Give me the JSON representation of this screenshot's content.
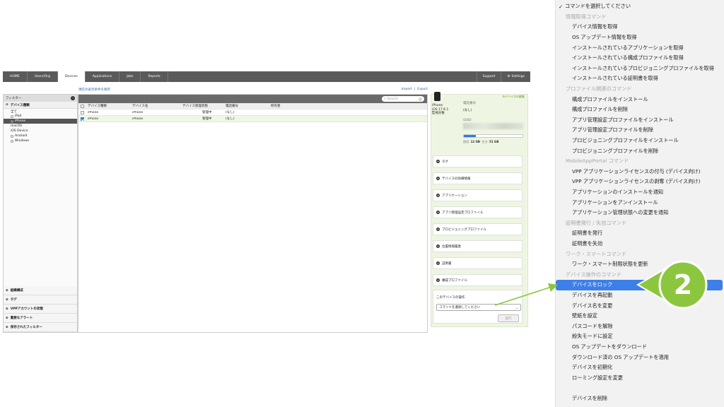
{
  "nav": {
    "tabs": [
      "HOME",
      "Users/Org",
      "Devices",
      "Applications",
      "Jobs",
      "Reports"
    ],
    "active_tab": "Devices",
    "support": "Support",
    "settings": "Settings"
  },
  "sidebar": {
    "filter_label": "フィルター",
    "device_type_group": "デバイス種類",
    "items": [
      "全て",
      "iPad",
      "iPhone",
      "macOS",
      "iOS Device",
      "Android",
      "Windows"
    ],
    "selected": "iPhone",
    "bottom_groups": [
      "組織構成",
      "タグ",
      "VPPアカウントの状態",
      "重要なアラート",
      "保存されたフィルター"
    ]
  },
  "main": {
    "save_filter_link": "現在の表示条件を保存",
    "import": "Import",
    "export": "Export",
    "search_placeholder": "Search",
    "columns": [
      "デバイス種類",
      "デバイス名",
      "デバイス管理状態",
      "電話番号",
      "所有者"
    ],
    "rows": [
      {
        "type": "iPhone",
        "name": "iPhone",
        "status": "管理中",
        "phone": "(なし)",
        "owner": "",
        "checked": false
      },
      {
        "type": "iPhone",
        "name": "iPhone",
        "status": "管理中",
        "phone": "(なし)",
        "owner": "",
        "checked": true
      }
    ]
  },
  "detail": {
    "edit_link": "デバイスの編集",
    "device_name": "iPhone",
    "os": "iOS 17.6.1",
    "status": "監視対象",
    "phone_label": "電話番号",
    "phone_value": "(なし)",
    "udid_label": "UDID",
    "storage_used_fraction": 0.2,
    "storage_used_label": "使用",
    "storage_used": "12 GB",
    "storage_free_label": "空き",
    "storage_free": "51 GB",
    "sections": [
      "タグ",
      "デバイスの詳細情報",
      "アプリケーション",
      "アプリ管理設定プロファイル",
      "プロビジョニングプロファイル",
      "位置情報履歴",
      "証明書",
      "構成プロファイル"
    ],
    "ops_title": "このデバイスの操作",
    "command_placeholder": "コマンドを選択してください",
    "run_button": "実行"
  },
  "menu": {
    "top": "コマンドを選択してください",
    "info_header": "情報取得コマンド",
    "info_items": [
      "デバイス情報を取得",
      "OS アップデート情報を取得",
      "インストールされているアプリケーションを取得",
      "インストールされている構成プロファイルを取得",
      "インストールされているプロビジョニングプロファイルを取得",
      "インストールされている証明書を取得"
    ],
    "profile_header": "プロファイル関連のコマンド",
    "profile_items": [
      "構成プロファイルをインストール",
      "構成プロファイルを削除",
      "アプリ管理設定プロファイルをインストール",
      "アプリ管理設定プロファイルを削除",
      "プロビジョニングプロファイルをインストール",
      "プロビジョニングプロファイルを削除"
    ],
    "mobileportal_header": "MobileAppPortal コマンド",
    "mobileportal_items": [
      "VPP アプリケーションライセンスの付与 (デバイス向け)",
      "VPP アプリケーションライセンスの剥奪 (デバイス向け)",
      "アプリケーションのインストールを通知",
      "アプリケーションをアンインストール",
      "アプリケーション管理状態への変更を通知"
    ],
    "cert_header": "証明書発行 / 失効コマンド",
    "cert_items": [
      "証明書を発行",
      "証明書を失効"
    ],
    "smart_header": "ワーク・スマートコマンド",
    "smart_items": [
      "ワーク・スマート制限状態を更新"
    ],
    "device_header": "デバイス操作のコマンド",
    "device_items": [
      "デバイスをロック",
      "デバイスを再起動",
      "デバイス名を変更",
      "壁紙を設定",
      "パスコードを解除",
      "紛失モードに設定",
      "OS アップデートをダウンロード",
      "ダウンロード済の OS アップデートを適用",
      "デバイスを初期化",
      "ローミング設定を変更"
    ],
    "delete_item": "デバイスを削除",
    "highlighted": "デバイスをロック"
  },
  "annotation": {
    "step_number": "2",
    "accent_color": "#8cc63f",
    "highlight_color": "#3d7fe8"
  }
}
